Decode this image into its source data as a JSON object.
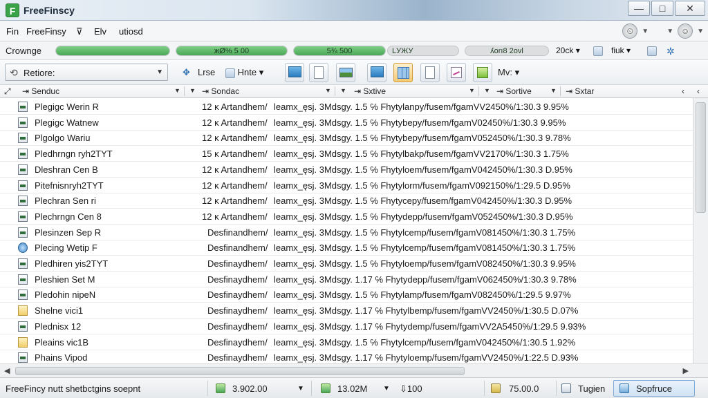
{
  "window": {
    "title": "FreeFinscy",
    "app_icon_letter": "F",
    "minimize": "—",
    "maximize": "□",
    "close": "✕"
  },
  "menu": {
    "items": [
      "Fin",
      "FreeFinsy",
      "⊽",
      "Elv",
      "utiosd"
    ]
  },
  "progress": {
    "label": "Crownge",
    "bars": [
      {
        "text": "",
        "fraction": 1.0
      },
      {
        "text": "жØ% 5 00",
        "fraction": 1.0
      },
      {
        "text": "5¾ 500",
        "fraction": 1.0
      },
      {
        "text": "LУЖУ",
        "fraction": 0.0
      },
      {
        "text": "ʎorı8 2ovl",
        "fraction": 0.0
      }
    ],
    "zoom": "20ck",
    "right_label": "fiuk"
  },
  "toolbar": {
    "combo_label": "Retiore:",
    "item1": "Lrse",
    "item2": "Hnte",
    "more": "Mv:"
  },
  "columns": [
    "Senduc",
    "Sondac",
    "Sxtive",
    "Sortive",
    "Sxtar"
  ],
  "rows": [
    {
      "icon": "doc",
      "name": "Plegigc Werin R",
      "prefix": "12 ĸ Artandhem/",
      "detail": "leamx_ęsj. 3Mdsgy. 1.5 ℅ Fhytylanpy/fusem/fgamVV2450%/1:30.3 9.95%"
    },
    {
      "icon": "doc",
      "name": "Plegigc Watnew",
      "prefix": "12 ĸ Artandhem/",
      "detail": "leamx_ęsj. 3Mdsgy. 1.5 ℅ Fhytybepy/fusem/fgamV02450%/1:30.3 9.95%"
    },
    {
      "icon": "doc",
      "name": "Plgolgo Wariu",
      "prefix": "12 ĸ Artandhem/",
      "detail": "leamx_ęsj. 3Mdsgy. 1.5 ℅ Fhytybepy/fusem/fgamV052450%/1:30.3 9.78%"
    },
    {
      "icon": "doc",
      "name": "Pledhrngn ryh2TYT",
      "prefix": "15 ĸ Artandhem/",
      "detail": "leamx_ęsj. 3Mdsgy. 1.5 ℅ Fhytylbakp/fusem/fgamVV2170%/1:30.3 1.75%"
    },
    {
      "icon": "doc",
      "name": "Dleshran Cen B",
      "prefix": "12 ĸ Artandhem/",
      "detail": "leamx_ęsj. 3Mdsgy. 1.5 ℅ Fhytyloem/fusem/fgamV042450%/1:30.3 D.95%"
    },
    {
      "icon": "doc",
      "name": "Pitefnisnryh2TYT",
      "prefix": "12 ĸ Artandhem/",
      "detail": "leamx_ęsj. 3Mdsgy. 1.5 ℅ Fhytylorm/fusem/fgamV092150%/1:29.5 D.95%"
    },
    {
      "icon": "doc",
      "name": "Plechran Sen ri",
      "prefix": "12 ĸ Artandhem/",
      "detail": "leamx_ęsj. 3Mdsgy. 1.5 ℅ Fhytycepy/fusem/fgamV042450%/1:30.3 D.95%"
    },
    {
      "icon": "doc",
      "name": "Plechrngn Cen 8",
      "prefix": "12 ĸ Artandhem/",
      "detail": "leamx_ęsj. 3Mdsgy. 1.5 ℅ Fhytydepp/fusem/fgamV052450%/1:30.3 D.95%"
    },
    {
      "icon": "doc",
      "name": "Plesinzen Sep R",
      "prefix": "Desfinandhem/",
      "detail": "leamx_ęsj. 3Mdsgy. 1.5 ℅ Fhytylcemp/fusem/fgamV081450%/1:30.3 1.75%"
    },
    {
      "icon": "globe",
      "name": "Plecing Wetip F",
      "prefix": "Desfinandhem/",
      "detail": "leamx_ęsj. 3Mdsgy. 1.5 ℅ Fhytylcemp/fusem/fgamV081450%/1:30.3 1.75%"
    },
    {
      "icon": "doc",
      "name": "Pledhiren yis2TYT",
      "prefix": "Desfinaydhem/",
      "detail": "leamx_ęsj. 3Mdsgy. 1.5 ℅ Fhytyloemp/fusem/fgamV082450%/1:30.3 9.95%"
    },
    {
      "icon": "doc",
      "name": "Pleshien Set M",
      "prefix": "Desfinaydhem/",
      "detail": "leamx_ęsj. 3Mdsgy. 1.17 ℅ Fhytydepp/fusem/fgamV062450%/1:30.3 9.78%"
    },
    {
      "icon": "doc",
      "name": "Pledohin nipeN",
      "prefix": "Desfinaydhem/",
      "detail": "leamx_ęsj. 3Mdsgy. 1.5 ℅ Fhytylamp/fusem/fgamV082450%/1:29.5 9.97%"
    },
    {
      "icon": "folder",
      "name": "Shelne vici1",
      "prefix": "Desfinaydhem/",
      "detail": "leamx_ęsj. 3Mdsgy. 1.17 ℅ Fhytylbemp/fusem/fgamVV2450%/1:30.5 D.07%"
    },
    {
      "icon": "doc",
      "name": "Plednisx 12",
      "prefix": "Desfinaydhem/",
      "detail": "leamx_ęsj. 3Mdsgy. 1.17 ℅ Fhytydemp/fusem/fgamVV2A5450%/1:29.5 9.93%"
    },
    {
      "icon": "folder",
      "name": "Pleains vic1B",
      "prefix": "Desfinaydhem/",
      "detail": "leamx_ęsj. 3Mdsgy. 1.5 ℅ Fhytylcemp/fusem/fgamV042450%/1:30.5 1.92%"
    },
    {
      "icon": "doc",
      "name": "Phains Vipod",
      "prefix": "Desfinaydhem/",
      "detail": "leamx_ęsj. 3Mdsgy. 1.17 ℅ Fhytyloemp/fusem/fgamVV2450%/1:22.5 D.93%"
    }
  ],
  "status": {
    "text": "FreeFincy nutt shetbctgins soepnt",
    "value1": "3.902.00",
    "value2": "13.02M",
    "value3": "100",
    "value4": "75.00.0",
    "label5": "Tugien",
    "active": "Sopfruce"
  }
}
